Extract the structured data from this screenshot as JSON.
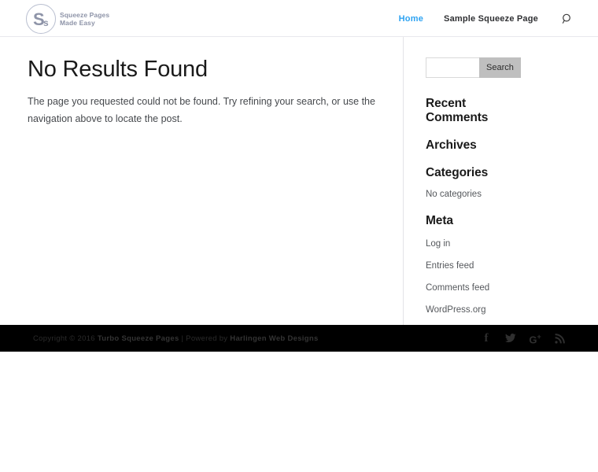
{
  "header": {
    "logo": {
      "mark_primary": "S",
      "mark_secondary": "s",
      "line1": "Squeeze Pages",
      "line2": "Made Easy",
      "icon_name": "site-logo"
    },
    "nav": [
      {
        "label": "Home",
        "active": true
      },
      {
        "label": "Sample Squeeze Page",
        "active": false
      }
    ],
    "search_icon": "search-icon"
  },
  "main": {
    "title": "No Results Found",
    "body": "The page you requested could not be found. Try refining your search, or use the navigation above to locate the post."
  },
  "sidebar": {
    "search": {
      "value": "",
      "placeholder": "",
      "button_label": "Search"
    },
    "widgets": [
      {
        "title": "Recent Comments",
        "note": "",
        "items": []
      },
      {
        "title": "Archives",
        "note": "",
        "items": []
      },
      {
        "title": "Categories",
        "note": "No categories",
        "items": []
      },
      {
        "title": "Meta",
        "note": "",
        "items": [
          "Log in",
          "Entries feed",
          "Comments feed",
          "WordPress.org"
        ]
      }
    ]
  },
  "footer": {
    "copyright_prefix": "Copyright © 2016 ",
    "site_name": "Turbo Squeeze Pages",
    "separator": " | Powered by ",
    "credit": "Harlingen Web Designs",
    "social": [
      {
        "name": "facebook-icon",
        "label": "f"
      },
      {
        "name": "twitter-icon",
        "label": ""
      },
      {
        "name": "google-plus-icon",
        "label": "G"
      },
      {
        "name": "rss-icon",
        "label": ""
      }
    ]
  },
  "colors": {
    "accent_blue": "#2ea3f2",
    "footer_bg": "#000000",
    "button_gray": "#bfbfbf",
    "logo_gray": "#8e94a8"
  }
}
